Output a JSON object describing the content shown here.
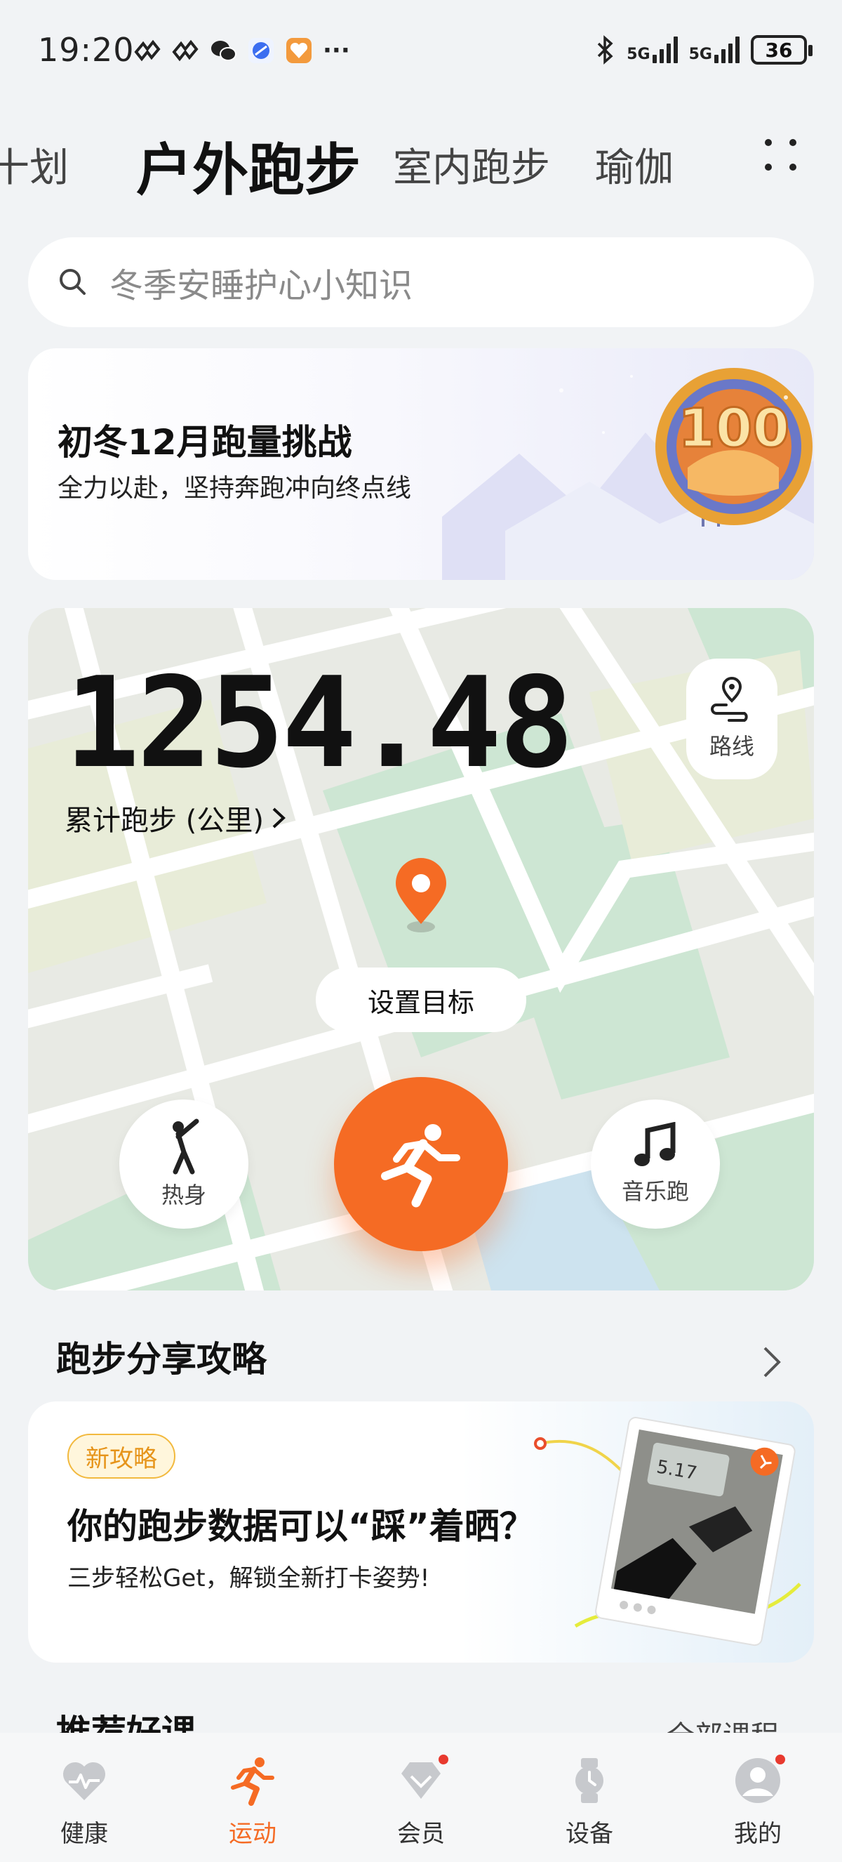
{
  "status_bar": {
    "time": "19:20",
    "network_1": "5G",
    "network_2": "5G",
    "battery": "36",
    "more": "···"
  },
  "tabs": [
    {
      "label": "计划",
      "visible_text": "十划"
    },
    {
      "label": "户外跑步",
      "active": true
    },
    {
      "label": "室内跑步"
    },
    {
      "label": "瑜伽"
    }
  ],
  "search": {
    "placeholder": "冬季安睡护心小知识"
  },
  "banner": {
    "title": "初冬12月跑量挑战",
    "subtitle": "全力以赴，坚持奔跑冲向终点线",
    "medal_text": "100"
  },
  "run_card": {
    "distance": "1254.48",
    "distance_label": "累计跑步 (公里)",
    "route_label": "路线",
    "goal_label": "设置目标",
    "warmup_label": "热身",
    "music_label": "音乐跑"
  },
  "share_section": {
    "title": "跑步分享攻略",
    "badge": "新攻略",
    "card_title": "你的跑步数据可以“踩”着晒？",
    "card_subtitle": "三步轻松Get，解锁全新打卡姿势!",
    "photo_text": "5.17"
  },
  "next_section": {
    "title": "推荐好课",
    "link": "全部课程"
  },
  "bottom_nav": [
    {
      "label": "健康",
      "icon": "heart-icon"
    },
    {
      "label": "运动",
      "icon": "runner-icon",
      "active": true
    },
    {
      "label": "会员",
      "icon": "diamond-icon",
      "badge": true
    },
    {
      "label": "设备",
      "icon": "watch-icon"
    },
    {
      "label": "我的",
      "icon": "profile-icon",
      "badge": true
    }
  ],
  "colors": {
    "accent": "#f56b24",
    "badge_red": "#e83a2f",
    "map_green": "#cde6d3",
    "map_water": "#cde3ef"
  }
}
